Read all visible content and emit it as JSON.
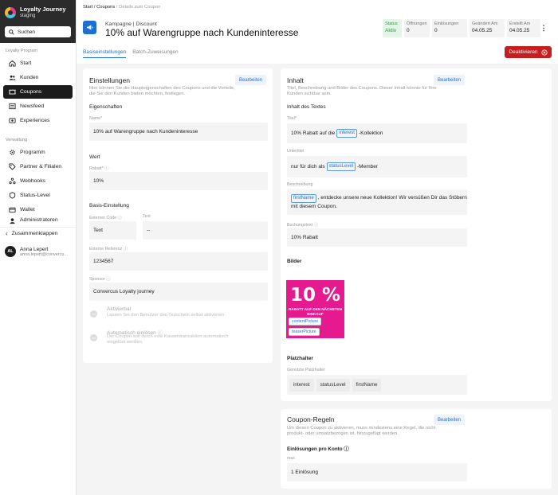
{
  "sidebar": {
    "brand_name": "Loyalty Journey",
    "brand_sub": "staging",
    "search_label": "Suchen",
    "section_program": "Loyalty Program",
    "program_items": [
      {
        "label": "Start"
      },
      {
        "label": "Kunden"
      },
      {
        "label": "Coupons"
      },
      {
        "label": "Newsfeed"
      },
      {
        "label": "Experiences"
      }
    ],
    "section_admin": "Verwaltung",
    "admin_items": [
      {
        "label": "Programm"
      },
      {
        "label": "Partner & Filialen"
      },
      {
        "label": "Webhooks"
      },
      {
        "label": "Status-Level"
      },
      {
        "label": "Wallet"
      },
      {
        "label": "Administratoren"
      }
    ],
    "collapse_label": "Zusammenklappen",
    "user_initials": "AL",
    "user_name": "Anna Lepert",
    "user_email": "anna.lepert@convercu..."
  },
  "breadcrumb": {
    "start": "Start",
    "sep1": " / ",
    "coupons": "Coupons",
    "sep2": " / ",
    "current": "Details zum Coupon"
  },
  "header": {
    "subtitle": "Kampagne | Discount",
    "title": "10% auf Warengruppe nach Kundeninteresse"
  },
  "stats": [
    {
      "label": "Status",
      "value": "Aktiv"
    },
    {
      "label": "Öffnungen",
      "value": "0"
    },
    {
      "label": "Einlösungen",
      "value": "0"
    },
    {
      "label": "Geändert Am",
      "value": "04.05.25"
    },
    {
      "label": "Erstellt Am",
      "value": "04.05.25"
    }
  ],
  "tabs": [
    {
      "label": "Basiseinstellungen"
    },
    {
      "label": "Batch-Zuweisungen"
    }
  ],
  "deactivate_label": "Deaktivieren",
  "settings": {
    "title": "Einstellungen",
    "edit_label": "Bearbeiten",
    "desc": "Hier können Sie die Haupteigenschaften des Coupons und die Vorteile, die Sie den Kunden bieten möchten, festlegen.",
    "props_label": "Eigenschaften",
    "name_label": "Name*",
    "name_value": "10% auf Warengruppe nach Kundeninteresse",
    "value_section": "Wert",
    "discount_label": "Rabatt*",
    "discount_value": "10%",
    "basis_section": "Basis-Einstellung",
    "ext_code_label": "Externer Code",
    "ext_code_value": "Text",
    "text_label": "Text",
    "text_value": "--",
    "ext_ref_label": "Externe Referenz",
    "ext_ref_value": "1234567",
    "sponsor_label": "Sponsor",
    "sponsor_value": "Convercus Loyalty journey",
    "toggle_off": "off",
    "activatable_title": "Aktivierbar",
    "activatable_desc": "Lassen Sie den Benutzer den Gutschein selbst aktivieren",
    "auto_title": "Automatisch einlösen",
    "auto_desc": "Der Coupon soll durch eine Kassentransaktion automatisch eingelöst werden."
  },
  "content": {
    "title": "Inhalt",
    "edit_label": "Bearbeiten",
    "desc": "Titel, Beschreibung und Bilder des Coupons. Dieser Inhalt könnte für Ihre Kunden sichtbar sein.",
    "text_section": "Inhalt des Textes",
    "title_label": "Titel*",
    "title_pre": "10% Rabatt auf die",
    "title_var": "interest",
    "title_post": "-Kollektion",
    "subtitle_label": "Untertitel",
    "subtitle_pre": "nur für dich als",
    "subtitle_var": "statusLevel",
    "subtitle_post": "-Member",
    "desc_label": "Beschreibung",
    "desc_var": "firstName",
    "desc_text": ", entdecke unsere neue Kollektion! Wir versüßen Dir das Stöbern mit diesem Coupon.",
    "booking_label": "Buchungstext",
    "booking_value": "10% Rabatt",
    "images_section": "Bilder",
    "promo_big": "10 %",
    "promo_small": "RABATT AUF DEN NÄCHSTEN EINKAUF",
    "img_chip_1": "contentPicture",
    "img_chip_2": "teaserPicture",
    "placeholder_section": "Platzhalter",
    "placeholder_used": "Genutzte Platzhalter",
    "placeholders": [
      "interest",
      "statusLevel",
      "firstName"
    ]
  },
  "rules": {
    "title": "Coupon-Regeln",
    "edit_label": "Bearbeiten",
    "desc": "Um diesen Coupon zu aktivieren, muss mindestens eine Regel, die nicht produkt- oder umsatzbezogen ist, hinzugefügt werden.",
    "per_account_label": "Einlösungen pro Konto",
    "max_label": "max",
    "max_value": "1 Einlösung"
  },
  "colors": {
    "primary": "#1f6fd1",
    "danger": "#c41e1e",
    "promo": "#e51a8f",
    "active_status": "#2d9a3f",
    "sidebar_dark": "#2b2b2b"
  }
}
